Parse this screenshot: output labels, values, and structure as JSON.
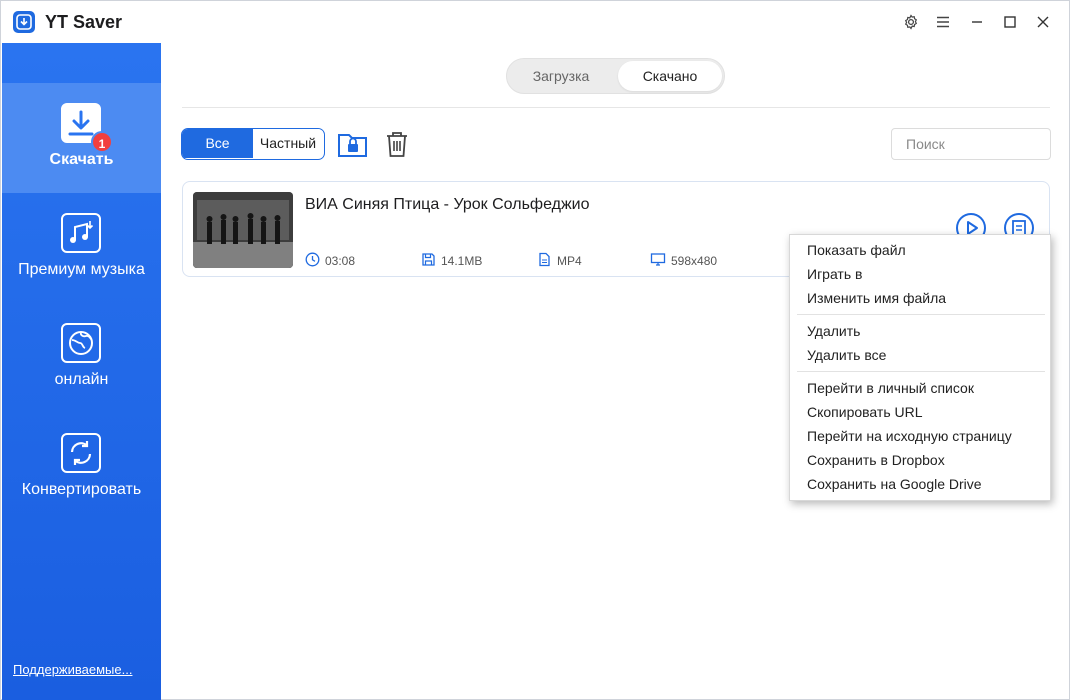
{
  "app": {
    "title": "YT Saver"
  },
  "sidebar": {
    "items": [
      {
        "label": "Скачать",
        "icon": "download-icon",
        "badge": "1",
        "active": true
      },
      {
        "label": "Премиум музыка",
        "icon": "music-icon",
        "active": false
      },
      {
        "label": "онлайн",
        "icon": "globe-icon",
        "active": false
      },
      {
        "label": "Конвертировать",
        "icon": "convert-icon",
        "active": false
      }
    ],
    "supported_link": "Поддерживаемые..."
  },
  "tabs": [
    {
      "label": "Загрузка",
      "active": false
    },
    {
      "label": "Скачано",
      "active": true
    }
  ],
  "filters": [
    {
      "label": "Все",
      "active": true
    },
    {
      "label": "Частный",
      "active": false
    }
  ],
  "toolbar": {
    "lock_icon": "lock-folder-icon",
    "trash_icon": "trash-icon"
  },
  "search": {
    "placeholder": "Поиск",
    "value": ""
  },
  "downloads": [
    {
      "title": "ВИА Синяя Птица - Урок Сольфеджио",
      "duration": "03:08",
      "size": "14.1MB",
      "format": "MP4",
      "resolution": "598x480"
    }
  ],
  "context_menu": {
    "groups": [
      [
        "Показать файл",
        "Играть в",
        "Изменить имя файла"
      ],
      [
        "Удалить",
        "Удалить все"
      ],
      [
        "Перейти в личный список",
        "Скопировать URL",
        "Перейти на исходную страницу",
        "Сохранить в Dropbox",
        "Сохранить на Google Drive"
      ]
    ]
  },
  "colors": {
    "accent": "#1f6ae0",
    "sidebar": "#2a74f0",
    "sidebar_active": "#4c8bf2",
    "badge": "#f23f3f"
  }
}
